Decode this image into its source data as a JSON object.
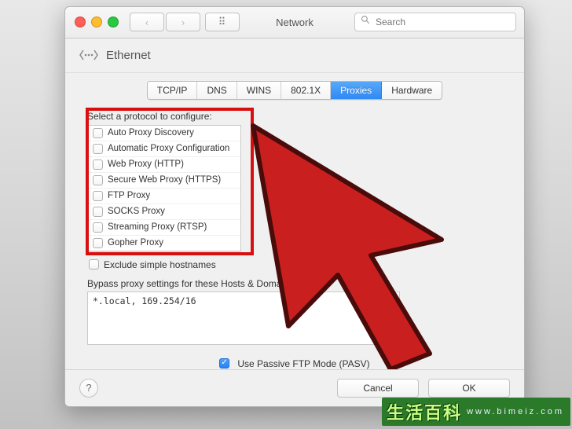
{
  "window": {
    "title": "Network",
    "search_placeholder": "Search"
  },
  "header": {
    "interface": "Ethernet"
  },
  "tabs": [
    {
      "label": "TCP/IP",
      "active": false
    },
    {
      "label": "DNS",
      "active": false
    },
    {
      "label": "WINS",
      "active": false
    },
    {
      "label": "802.1X",
      "active": false
    },
    {
      "label": "Proxies",
      "active": true
    },
    {
      "label": "Hardware",
      "active": false
    }
  ],
  "proxies": {
    "protocol_label": "Select a protocol to configure:",
    "protocols": [
      {
        "label": "Auto Proxy Discovery",
        "checked": false
      },
      {
        "label": "Automatic Proxy Configuration",
        "checked": false
      },
      {
        "label": "Web Proxy (HTTP)",
        "checked": false
      },
      {
        "label": "Secure Web Proxy (HTTPS)",
        "checked": false
      },
      {
        "label": "FTP Proxy",
        "checked": false
      },
      {
        "label": "SOCKS Proxy",
        "checked": false
      },
      {
        "label": "Streaming Proxy (RTSP)",
        "checked": false
      },
      {
        "label": "Gopher Proxy",
        "checked": false
      }
    ],
    "exclude_label": "Exclude simple hostnames",
    "exclude_checked": false,
    "bypass_label": "Bypass proxy settings for these Hosts & Domains:",
    "bypass_value": "*.local, 169.254/16",
    "passive_label": "Use Passive FTP Mode (PASV)",
    "passive_checked": true
  },
  "footer": {
    "help": "?",
    "cancel": "Cancel",
    "ok": "OK"
  },
  "watermark": {
    "cn": "生活百科",
    "url": "www.bimeiz.com"
  }
}
